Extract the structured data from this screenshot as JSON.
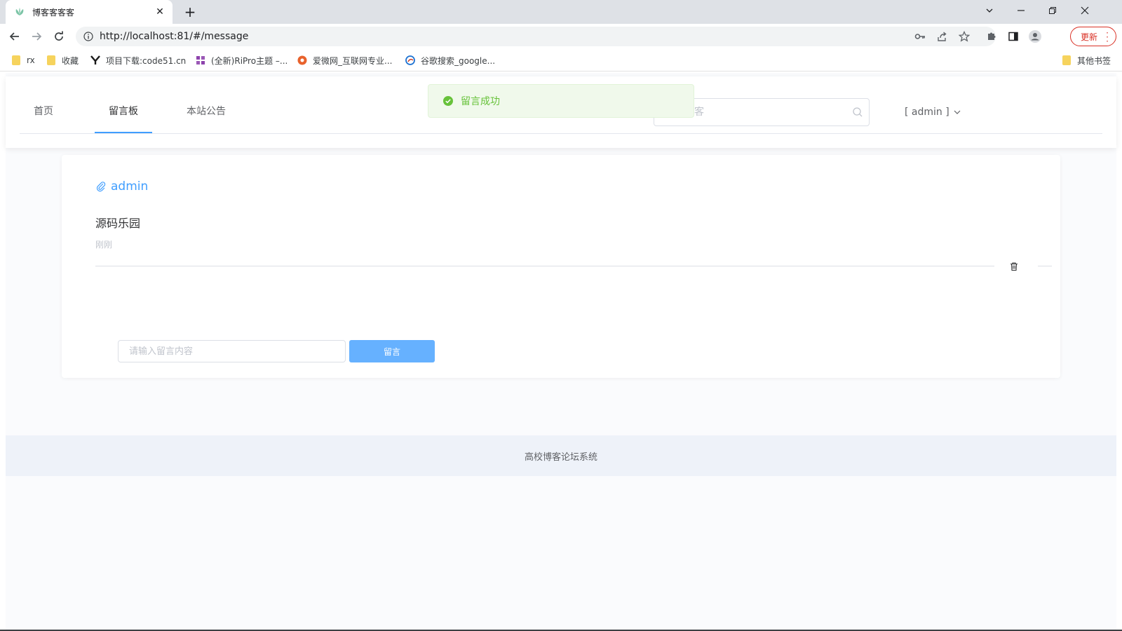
{
  "browser": {
    "tab_title": "博客客客客",
    "url": "http://localhost:81/#/message",
    "update_label": "更新",
    "bookmarks": [
      {
        "label": "rx",
        "icon": "folder-icon"
      },
      {
        "label": "收藏",
        "icon": "folder-icon"
      },
      {
        "label": "项目下载:code51.cn",
        "icon": "y-logo-icon"
      },
      {
        "label": "(全新)RiPro主题 –...",
        "icon": "site-logo-icon"
      },
      {
        "label": "爱微网_互联网专业...",
        "icon": "aiwei-logo-icon"
      },
      {
        "label": "谷歌搜索_google...",
        "icon": "360-logo-icon"
      }
    ],
    "other_bookmarks": "其他书签"
  },
  "header": {
    "nav": [
      {
        "label": "首页",
        "active": false
      },
      {
        "label": "留言板",
        "active": true
      },
      {
        "label": "本站公告",
        "active": false
      }
    ],
    "search_placeholder": "搜索博客",
    "user_label": "[ admin ]"
  },
  "toast": {
    "message": "留言成功",
    "color": "#67c23a"
  },
  "message_board": {
    "messages": [
      {
        "author": "admin",
        "content": "源码乐园",
        "time": "刚刚"
      }
    ],
    "input_placeholder": "请输入留言内容",
    "submit_label": "留言"
  },
  "footer": {
    "text": "高校博客论坛系统"
  },
  "colors": {
    "accent": "#409eff",
    "button": "#66b1ff",
    "success": "#67c23a"
  }
}
